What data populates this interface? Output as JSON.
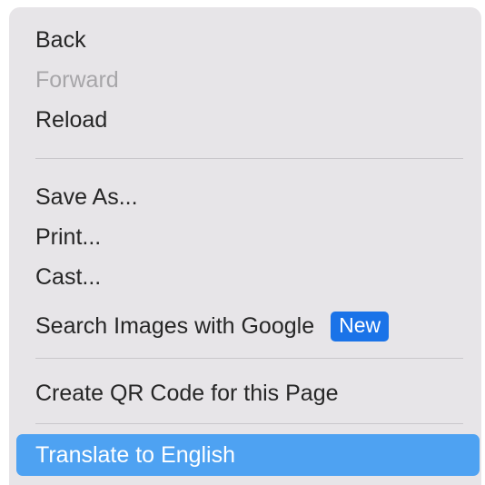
{
  "context_menu": {
    "items": [
      {
        "label": "Back",
        "enabled": true
      },
      {
        "label": "Forward",
        "enabled": false
      },
      {
        "label": "Reload",
        "enabled": true
      },
      {
        "label": "Save As...",
        "enabled": true
      },
      {
        "label": "Print...",
        "enabled": true
      },
      {
        "label": "Cast...",
        "enabled": true
      },
      {
        "label": "Search Images with Google",
        "enabled": true,
        "badge": "New"
      },
      {
        "label": "Create QR Code for this Page",
        "enabled": true
      },
      {
        "label": "Translate to English",
        "enabled": true,
        "highlighted": true
      }
    ],
    "colors": {
      "menu_background": "#e7e5e8",
      "text": "#262626",
      "disabled_text": "#a7a6a9",
      "highlight": "#4ea2f2",
      "badge": "#1a73e8"
    }
  }
}
